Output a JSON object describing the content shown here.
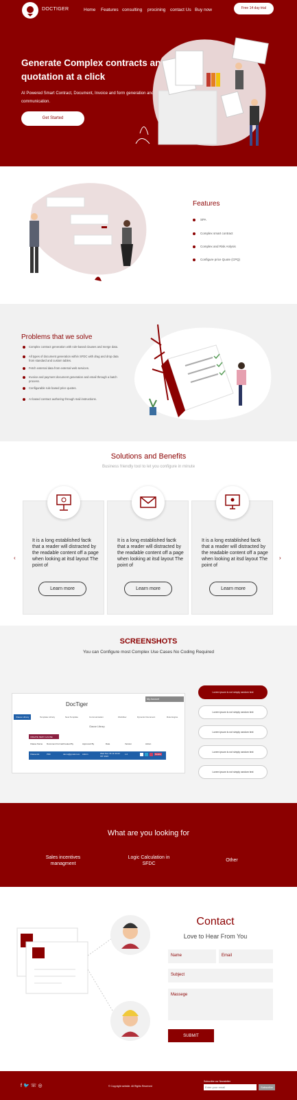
{
  "header": {
    "brand": "DOCTIGER",
    "nav": [
      "Home",
      "Features",
      "consulting",
      "procining",
      "contact Us",
      "Buy now"
    ],
    "trial_button": "Free 14 day trial"
  },
  "hero": {
    "title": "Generate Complex contracts and quotation at a click",
    "subtitle": "AI Powered Smart Contract, Document, Invoice and form generation and communication.",
    "cta": "Get Started"
  },
  "features": {
    "title": "Features",
    "items": [
      "SPA",
      "Complex smart contract",
      "Complex and Risk Anlysis",
      "Configure price Quote (CPQ)"
    ]
  },
  "problems": {
    "title": "Problems that we solve",
    "items": [
      "Complex contract generation with rule-based clauses and merge data.",
      "All types of document generation within SFDC with drag and drop data from standard and custom tables.",
      "Fetch external data from external web services.",
      "Invoice and payment document generation and email through a batch process.",
      "Configurable rule based price quotes.",
      "AI based contract authoring through mail instructions."
    ]
  },
  "solutions": {
    "title": "Solutions and Benefits",
    "subtitle": "Business friendly tool to let you configure in minute",
    "cards": [
      {
        "icon": "presentation-icon",
        "text": "It is a long established factk that a reader will distracted by the readable content off a page when looking at itsd layout The point of",
        "button": "Learn more"
      },
      {
        "icon": "envelope-icon",
        "text": "It is a long established factk that a reader will distracted by the readable content off a page when looking at itsd layout The point of",
        "button": "Learn more"
      },
      {
        "icon": "monitor-icon",
        "text": "It is a long established factk that a reader will distracted by the readable content off a page when looking at itsd layout The point of",
        "button": "Learn more"
      }
    ],
    "prev": "‹",
    "next": "›"
  },
  "screenshots": {
    "title": "SCREENSHOTS",
    "subtitle": "You can Configure most Complex Use Cases No Coding Required",
    "app": {
      "title": "DocTiger",
      "dropdown": "My Account",
      "tabs": [
        "Clause Library",
        "Template Library",
        "New Template",
        "Communication",
        "Workflow",
        "Dynamic Document",
        "Rule Engine"
      ],
      "section": "Clause Library",
      "create_button": "CREATE NEW CLAUSE",
      "columns": [
        "Clause Name",
        "Document Format",
        "Created By",
        "Approved By",
        "Date",
        "Version",
        "Action"
      ],
      "row": [
        "Clause1st",
        "PDF",
        "demo@gmail.com",
        "Admin",
        "Wed Nov 16 11:44:22 IST 2022",
        "1.0"
      ],
      "delete": "Delete"
    },
    "pills": [
      "Lorem ipsum is not simply random text",
      "Lorem ipsum is not simply random text",
      "Lorem ipsum is not simply random text",
      "Lorem ipsum is not simply random text",
      "Lorem ipsum is not simply random text"
    ]
  },
  "looking": {
    "title": "What are you looking for",
    "items": [
      "Sales incentives managment",
      "Logic Calculation in SFDC",
      "Other"
    ]
  },
  "contact": {
    "title": "Contact",
    "subtitle": "Love to Hear From You",
    "name_label": "Name",
    "email_label": "Email",
    "subject_label": "Subject",
    "message_label": "Massege",
    "submit": "SUBMIT"
  },
  "footer": {
    "social": [
      "f",
      "🐦",
      "☏",
      "◎"
    ],
    "copyright": "© Copyright website. All Rights Reserved",
    "newsletter_label": "Subscribe our Newsletter",
    "email_placeholder": "Enter your email",
    "subscribe": "Subscribe"
  },
  "colors": {
    "brand": "#8b0000",
    "light": "#f1f1f1"
  }
}
